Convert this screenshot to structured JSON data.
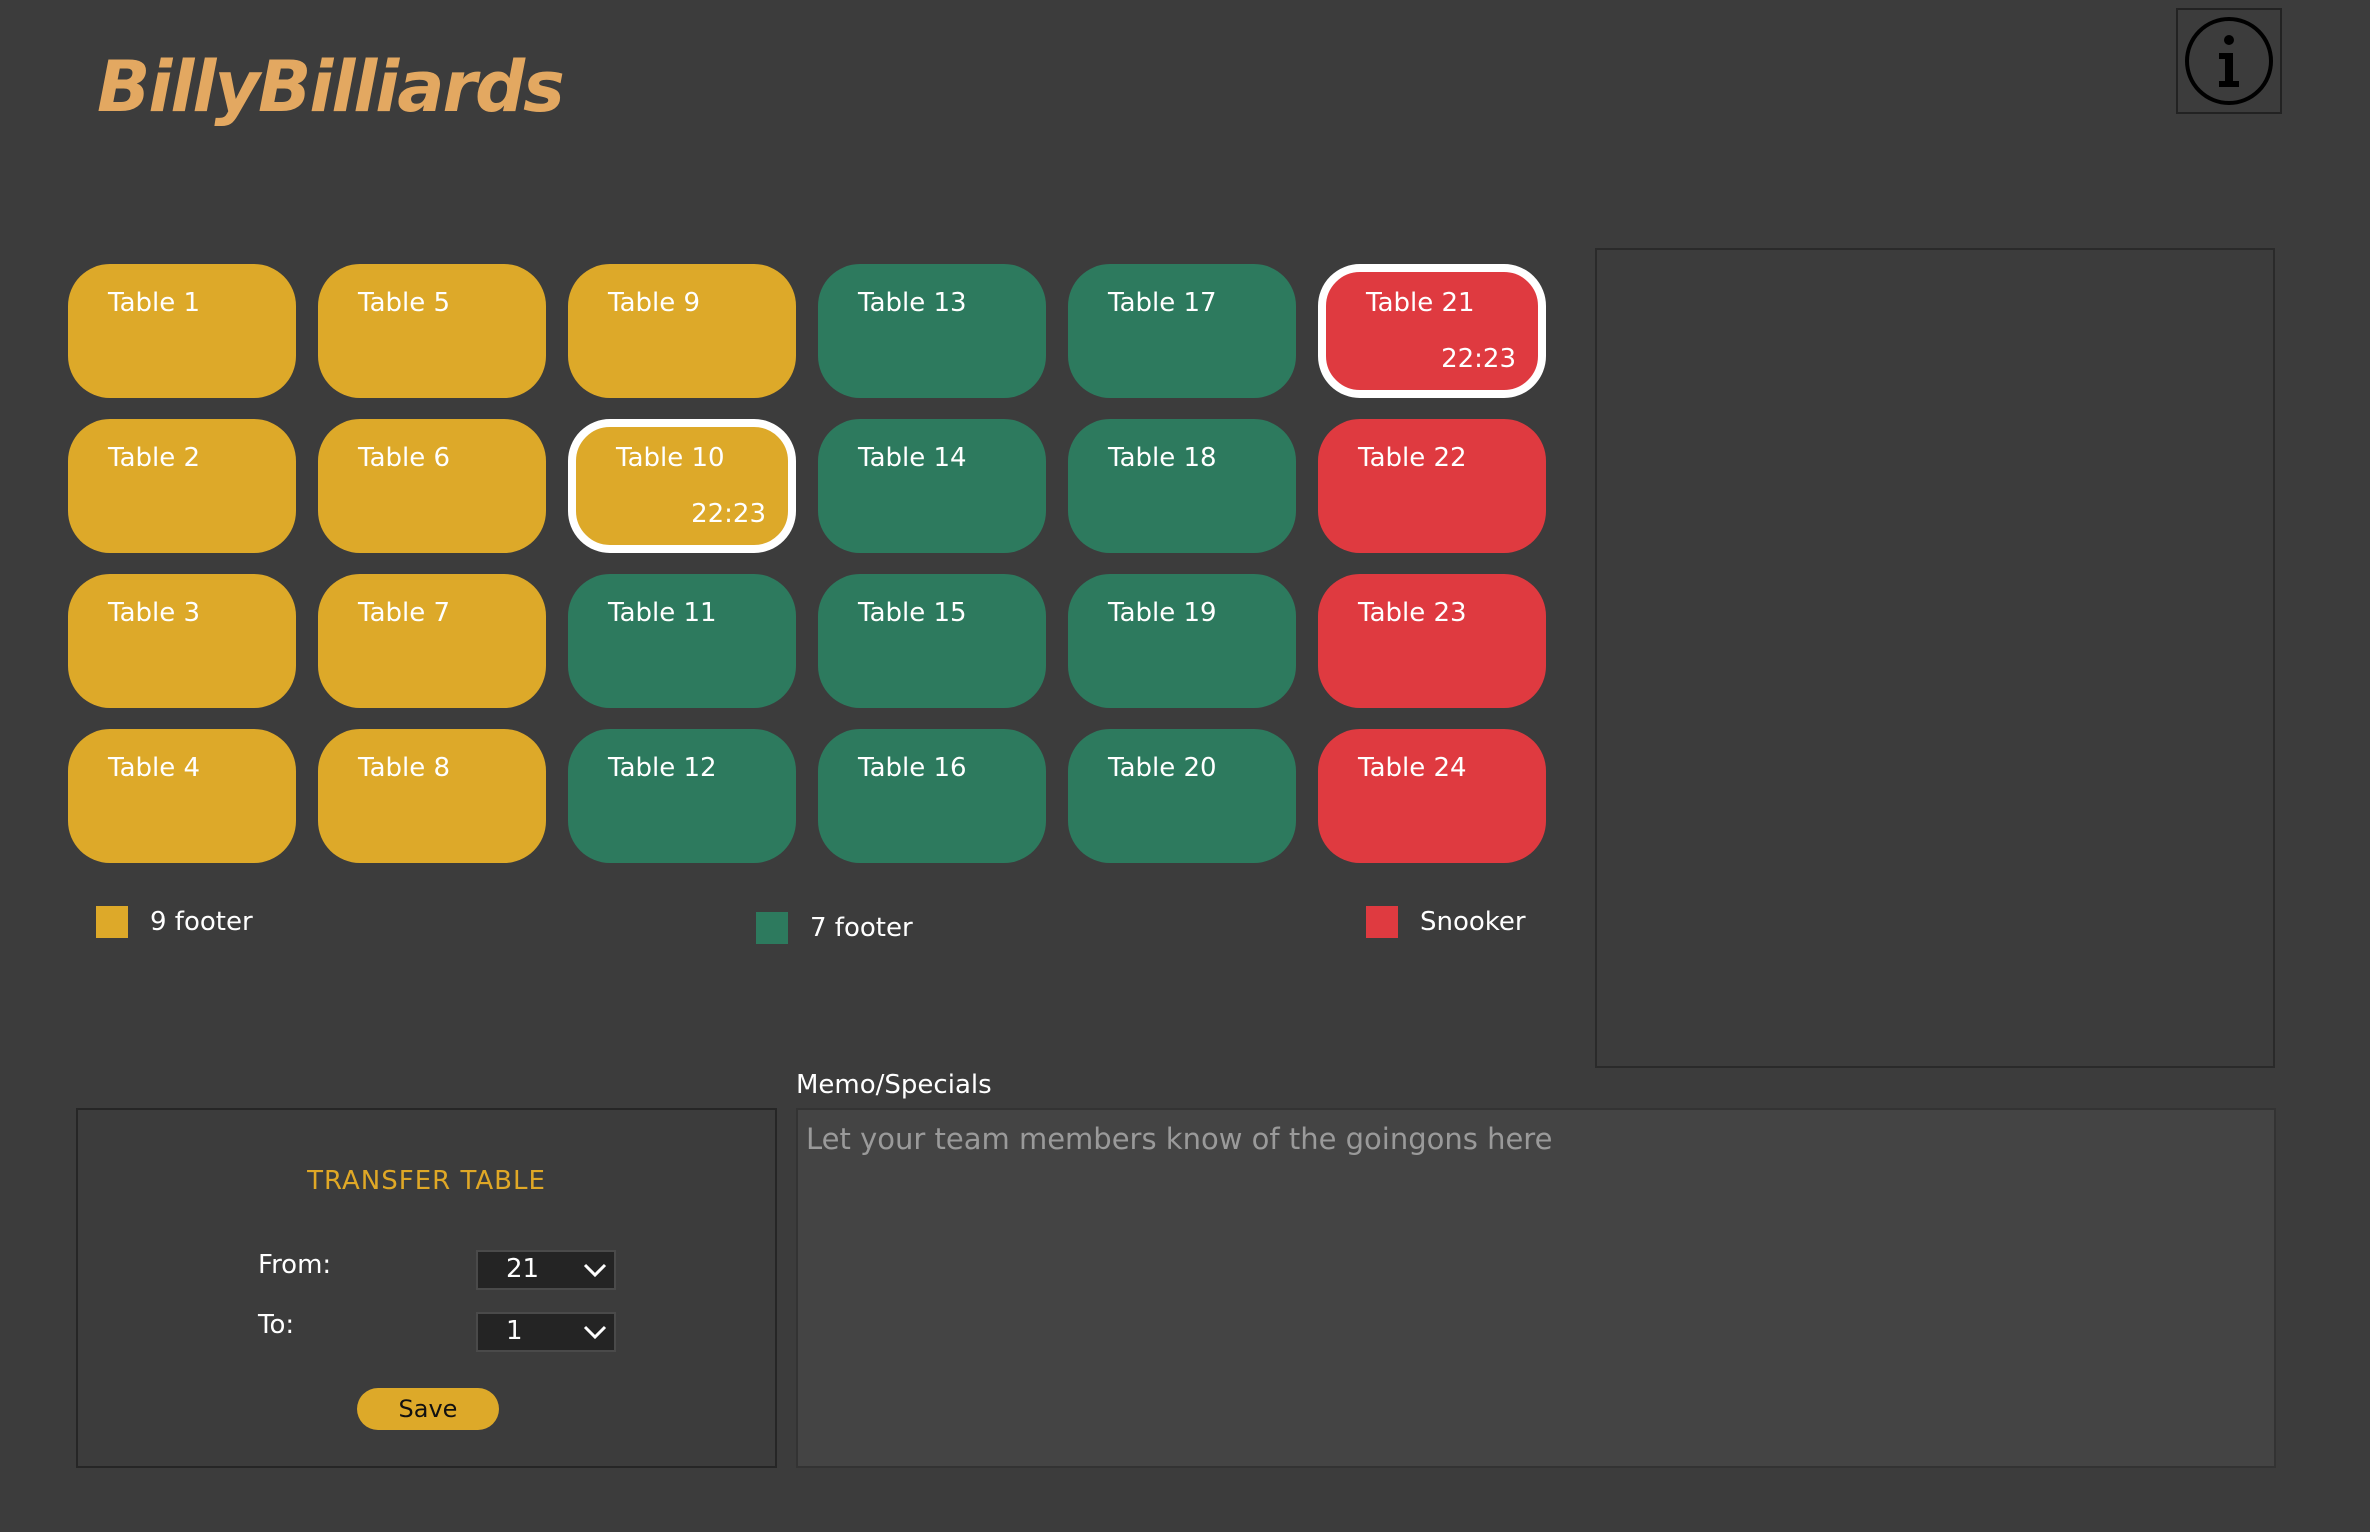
{
  "app": {
    "title": "BillyBilliards"
  },
  "colors": {
    "nine_footer": "#dda929",
    "seven_footer": "#2d7a5e",
    "snooker": "#df3a40"
  },
  "tables": [
    {
      "label": "Table 1",
      "type": "9ft",
      "time": ""
    },
    {
      "label": "Table 2",
      "type": "9ft",
      "time": ""
    },
    {
      "label": "Table 3",
      "type": "9ft",
      "time": ""
    },
    {
      "label": "Table 4",
      "type": "9ft",
      "time": ""
    },
    {
      "label": "Table 5",
      "type": "9ft",
      "time": ""
    },
    {
      "label": "Table 6",
      "type": "9ft",
      "time": ""
    },
    {
      "label": "Table 7",
      "type": "9ft",
      "time": ""
    },
    {
      "label": "Table 8",
      "type": "9ft",
      "time": ""
    },
    {
      "label": "Table 9",
      "type": "9ft",
      "time": ""
    },
    {
      "label": "Table 10",
      "type": "9ft",
      "time": "22:23",
      "active": true
    },
    {
      "label": "Table 11",
      "type": "7ft",
      "time": ""
    },
    {
      "label": "Table 12",
      "type": "7ft",
      "time": ""
    },
    {
      "label": "Table 13",
      "type": "7ft",
      "time": ""
    },
    {
      "label": "Table 14",
      "type": "7ft",
      "time": ""
    },
    {
      "label": "Table 15",
      "type": "7ft",
      "time": ""
    },
    {
      "label": "Table 16",
      "type": "7ft",
      "time": ""
    },
    {
      "label": "Table 17",
      "type": "7ft",
      "time": ""
    },
    {
      "label": "Table 18",
      "type": "7ft",
      "time": ""
    },
    {
      "label": "Table 19",
      "type": "7ft",
      "time": ""
    },
    {
      "label": "Table 20",
      "type": "7ft",
      "time": ""
    },
    {
      "label": "Table 21",
      "type": "snooker",
      "time": "22:23",
      "active": true
    },
    {
      "label": "Table 22",
      "type": "snooker",
      "time": ""
    },
    {
      "label": "Table 23",
      "type": "snooker",
      "time": ""
    },
    {
      "label": "Table 24",
      "type": "snooker",
      "time": ""
    }
  ],
  "legend": {
    "nine_footer": "9 footer",
    "seven_footer": "7 footer",
    "snooker": "Snooker"
  },
  "transfer": {
    "title": "TRANSFER TABLE",
    "from_label": "From:",
    "from_value": "21",
    "to_label": "To:",
    "to_value": "1",
    "save_label": "Save"
  },
  "memo": {
    "label": "Memo/Specials",
    "placeholder": "Let your team members know of the goingons here"
  }
}
